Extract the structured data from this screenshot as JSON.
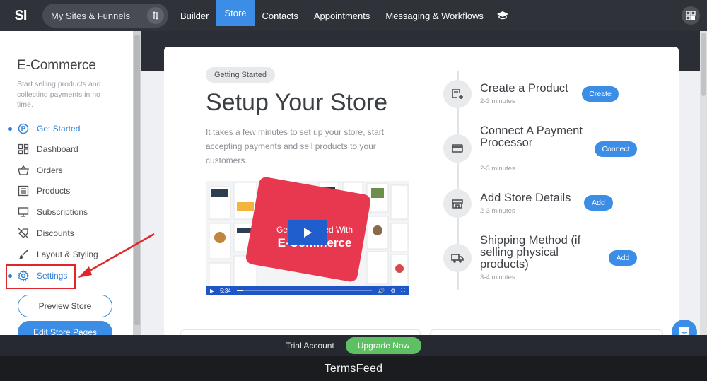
{
  "topbar": {
    "logo": "SI",
    "sites_label": "My Sites & Funnels",
    "nav": [
      "Builder",
      "Store",
      "Contacts",
      "Appointments",
      "Messaging & Workflows"
    ],
    "active_nav": "Store"
  },
  "sidebar": {
    "title": "E-Commerce",
    "description": "Start selling products and collecting payments in no time.",
    "items": [
      {
        "label": "Get Started",
        "icon": "rocket-icon"
      },
      {
        "label": "Dashboard",
        "icon": "dashboard-icon"
      },
      {
        "label": "Orders",
        "icon": "basket-icon"
      },
      {
        "label": "Products",
        "icon": "list-icon"
      },
      {
        "label": "Subscriptions",
        "icon": "monitor-icon"
      },
      {
        "label": "Discounts",
        "icon": "tag-off-icon"
      },
      {
        "label": "Layout & Styling",
        "icon": "brush-icon"
      },
      {
        "label": "Settings",
        "icon": "gear-icon"
      }
    ],
    "preview_button": "Preview Store",
    "edit_button": "Edit Store Pages"
  },
  "hero": {
    "tag": "Getting Started",
    "title": "Setup Your Store",
    "description": "It takes a few minutes to set up your store, start accepting payments and sell products to your customers."
  },
  "video": {
    "line1": "Getting Started With",
    "line2": "E-Commerce",
    "time": "5:34"
  },
  "steps": [
    {
      "title": "Create a Product",
      "time": "2-3 minutes",
      "button": "Create",
      "icon": "store-add-icon"
    },
    {
      "title": "Connect A Payment Processor",
      "time": "2-3 minutes",
      "button": "Connect",
      "icon": "card-icon"
    },
    {
      "title": "Add Store Details",
      "time": "2-3 minutes",
      "button": "Add",
      "icon": "storefront-icon"
    },
    {
      "title": "Shipping Method (if selling physical products)",
      "time": "3-4 minutes",
      "button": "Add",
      "icon": "truck-icon"
    }
  ],
  "trial": {
    "text": "Trial Account",
    "upgrade": "Upgrade Now"
  },
  "caption": "TermsFeed",
  "colors": {
    "accent": "#3b8de6",
    "upgrade": "#5fbf63",
    "annotation": "#e0262b"
  }
}
